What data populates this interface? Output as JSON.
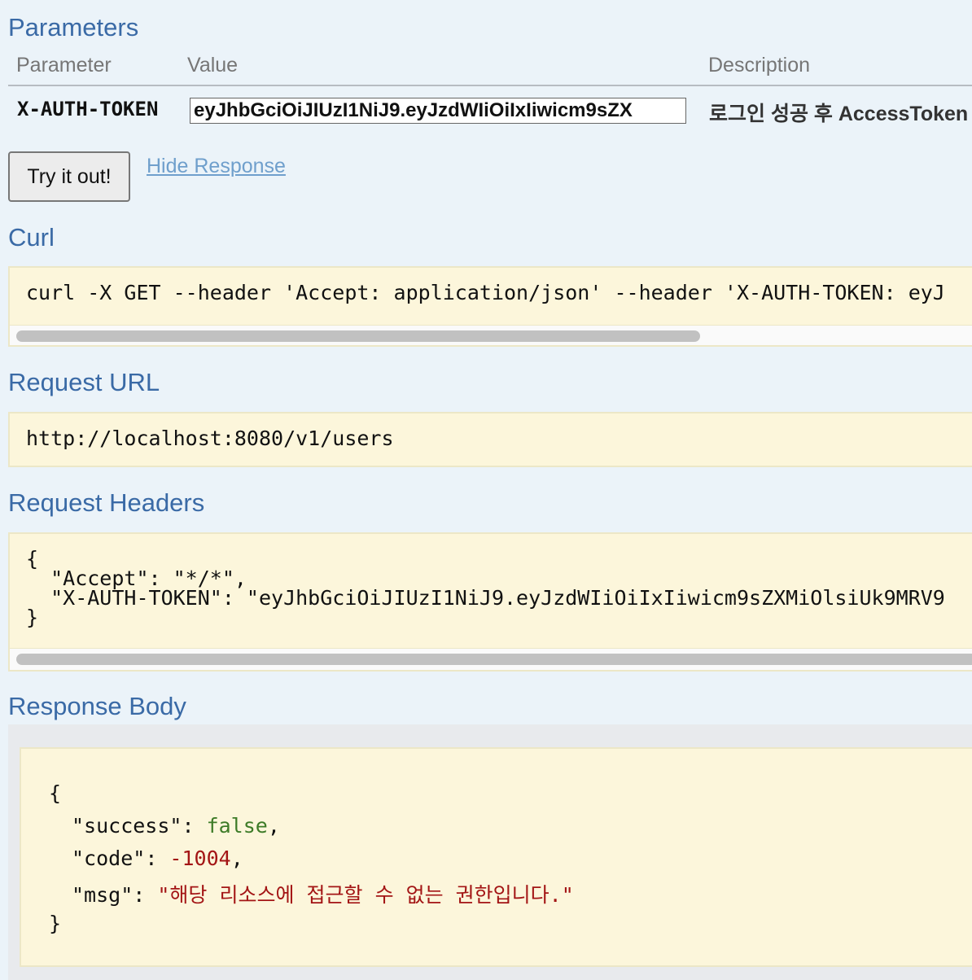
{
  "parameters": {
    "title": "Parameters",
    "headers": {
      "parameter": "Parameter",
      "value": "Value",
      "description": "Description"
    },
    "rows": [
      {
        "name": "X-AUTH-TOKEN",
        "value": "eyJhbGciOiJIUzI1NiJ9.eyJzdWIiOiIxIiwicm9sZX",
        "description": "로그인 성공 후 AccessToken"
      }
    ]
  },
  "actions": {
    "try_label": "Try it out!",
    "hide_response_label": "Hide Response"
  },
  "curl": {
    "title": "Curl",
    "command": "curl -X GET --header 'Accept: application/json' --header 'X-AUTH-TOKEN: eyJ"
  },
  "request_url": {
    "title": "Request URL",
    "url": "http://localhost:8080/v1/users"
  },
  "request_headers": {
    "title": "Request Headers",
    "open_brace": "{",
    "line1": "  \"Accept\": \"*/*\",",
    "line2": "  \"X-AUTH-TOKEN\": \"eyJhbGciOiJIUzI1NiJ9.eyJzdWIiOiIxIiwicm9sZXMiOlsiUk9MRV9",
    "close_brace": "}"
  },
  "response_body": {
    "title": "Response Body",
    "open_brace": "{",
    "success_key": "\"success\"",
    "success_value": "false",
    "code_key": "\"code\"",
    "code_value": "-1004",
    "msg_key": "\"msg\"",
    "msg_value": "\"해당 리소스에 접근할 수 없는 권한입니다.\"",
    "close_brace": "}"
  },
  "colors": {
    "background": "#ebf3f9",
    "title": "#3a6aa6",
    "link": "#6f9fcc",
    "code_bg": "#fcf6db",
    "json_bool": "#3d7b27",
    "json_number": "#a31515",
    "json_string": "#a31515"
  }
}
